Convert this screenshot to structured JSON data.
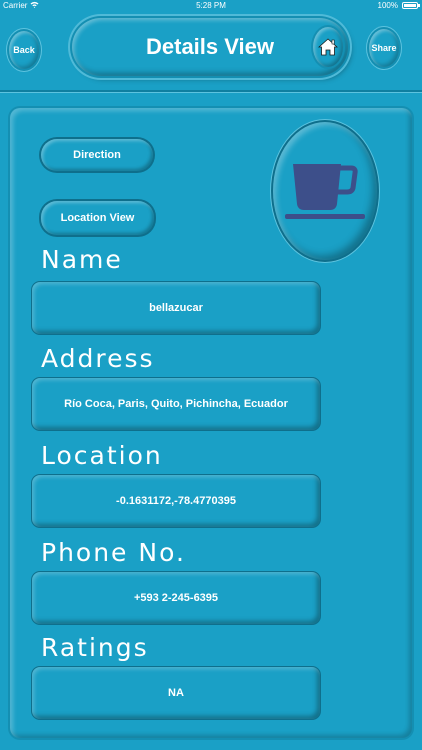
{
  "status_bar": {
    "carrier": "Carrier",
    "time": "5:28 PM",
    "battery": "100%"
  },
  "header": {
    "back_label": "Back",
    "title": "Details View",
    "share_label": "Share",
    "home_icon": "home-icon"
  },
  "actions": {
    "direction_label": "Direction",
    "location_view_label": "Location View"
  },
  "image": {
    "icon": "coffee-cup-icon"
  },
  "fields": {
    "name": {
      "label": "Name",
      "value": "bellazucar"
    },
    "address": {
      "label": "Address",
      "value": "Río Coca, Paris, Quito, Pichincha, Ecuador"
    },
    "location": {
      "label": "Location",
      "value": "-0.1631172,-78.4770395"
    },
    "phone": {
      "label": "Phone No.",
      "value": "+593 2-245-6395"
    },
    "ratings": {
      "label": "Ratings",
      "value": "NA"
    }
  },
  "colors": {
    "background": "#1aa0c6",
    "cup": "#3d4f8a",
    "text": "#ffffff"
  }
}
